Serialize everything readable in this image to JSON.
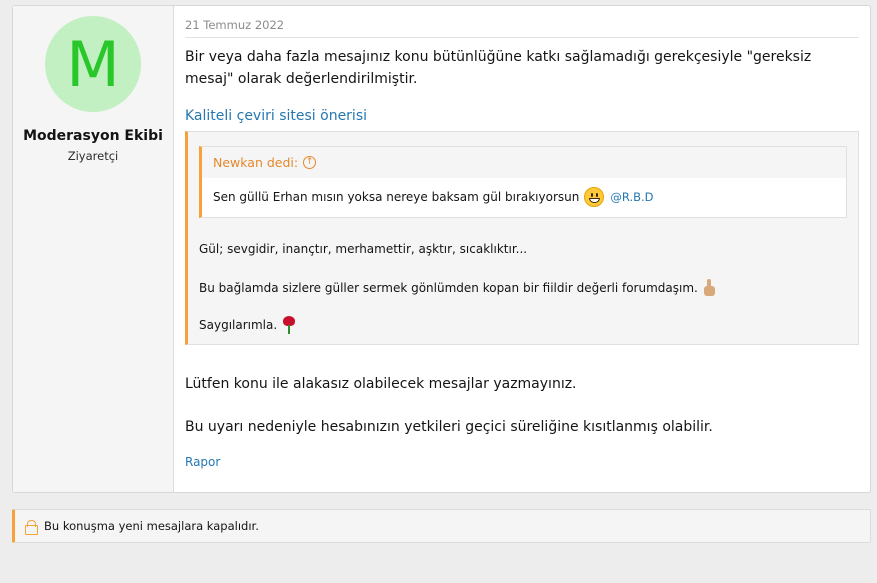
{
  "user": {
    "avatar_letter": "M",
    "name": "Moderasyon Ekibi",
    "title": "Ziyaretçi"
  },
  "post": {
    "date": "21 Temmuz 2022",
    "paragraph1": "Bir veya daha fazla mesajınız konu bütünlüğüne katkı sağlamadığı gerekçesiyle \"gereksiz mesaj\" olarak değerlendirilmiştir.",
    "quoted_link": "Kaliteli çeviri sitesi önerisi",
    "inner_quote": {
      "author": "Newkan dedi:",
      "text": "Sen güllü Erhan mısın yoksa nereye baksam gül bırakıyorsun",
      "mention": "@R.B.D"
    },
    "outer_lines": [
      "Gül; sevgidir, inançtır, merhamettir, aşktır, sıcaklıktır...",
      "Bu bağlamda sizlere güller sermek gönlümden kopan bir fiildir değerli forumdaşım.",
      "Saygılarımla."
    ],
    "paragraph2": "Lütfen konu ile alakasız olabilecek mesajlar yazmayınız.",
    "paragraph3": "Bu uyarı nedeniyle hesabınızın yetkileri geçici süreliğine kısıtlanmış olabilir.",
    "report_label": "Rapor"
  },
  "locked_notice": "Bu konuşma yeni mesajlara kapalıdır.",
  "icons": {
    "quote_up": "arrow-up-circle-icon",
    "grin": "grinning-face-icon",
    "finger": "pointing-up-icon",
    "rose": "rose-icon",
    "lock": "lock-icon"
  },
  "colors": {
    "accent": "#f7a13b",
    "link": "#2577b1",
    "avatar_bg": "#c2f0c2",
    "avatar_fg": "#2ac72a"
  }
}
